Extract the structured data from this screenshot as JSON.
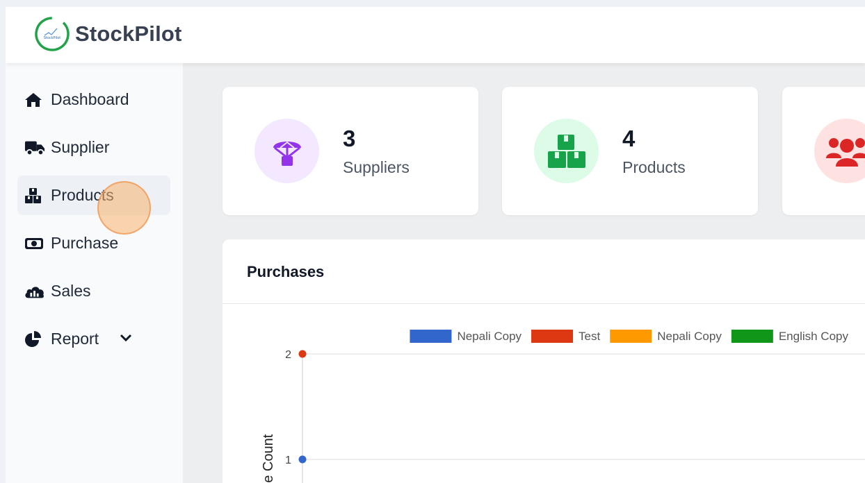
{
  "app": {
    "brand": "StockPilot",
    "logo_text": "StockPilot"
  },
  "sidebar": {
    "items": [
      {
        "label": "Dashboard",
        "icon": "home-icon"
      },
      {
        "label": "Supplier",
        "icon": "truck-icon"
      },
      {
        "label": "Products",
        "icon": "boxes-icon",
        "active": true
      },
      {
        "label": "Purchase",
        "icon": "money-bill-icon"
      },
      {
        "label": "Sales",
        "icon": "chart-cloud-icon"
      },
      {
        "label": "Report",
        "icon": "pie-chart-icon",
        "expandable": true,
        "expand_icon": "chevron-down-icon"
      }
    ]
  },
  "stats": [
    {
      "count": "3",
      "label": "Suppliers",
      "icon": "parachute-box-icon",
      "icon_color": "#9333ea",
      "bg_color": "#f3e8ff"
    },
    {
      "count": "4",
      "label": "Products",
      "icon": "boxes-icon",
      "icon_color": "#16a34a",
      "bg_color": "#dcfce7"
    },
    {
      "count": "",
      "label": "",
      "icon": "users-icon",
      "icon_color": "#dc2626",
      "bg_color": "#fee2e2"
    }
  ],
  "purchases_card": {
    "title": "Purchases"
  },
  "chart_data": {
    "type": "line",
    "title": "",
    "ylabel": "Purchase Count",
    "ylabel_visible": "hase Count",
    "yticks": [
      1,
      2
    ],
    "legend_position": "top",
    "grid": true,
    "series": [
      {
        "name": "Nepali Copy",
        "color": "#3366cc",
        "values": [
          1
        ]
      },
      {
        "name": "Test",
        "color": "#dc3912",
        "values": [
          2
        ]
      },
      {
        "name": "Nepali Copy",
        "color": "#ff9900",
        "values": []
      },
      {
        "name": "English Copy",
        "color": "#109618",
        "values": []
      }
    ]
  },
  "colors": {
    "accent": "#2563eb",
    "click_marker": "#f7b26e"
  }
}
